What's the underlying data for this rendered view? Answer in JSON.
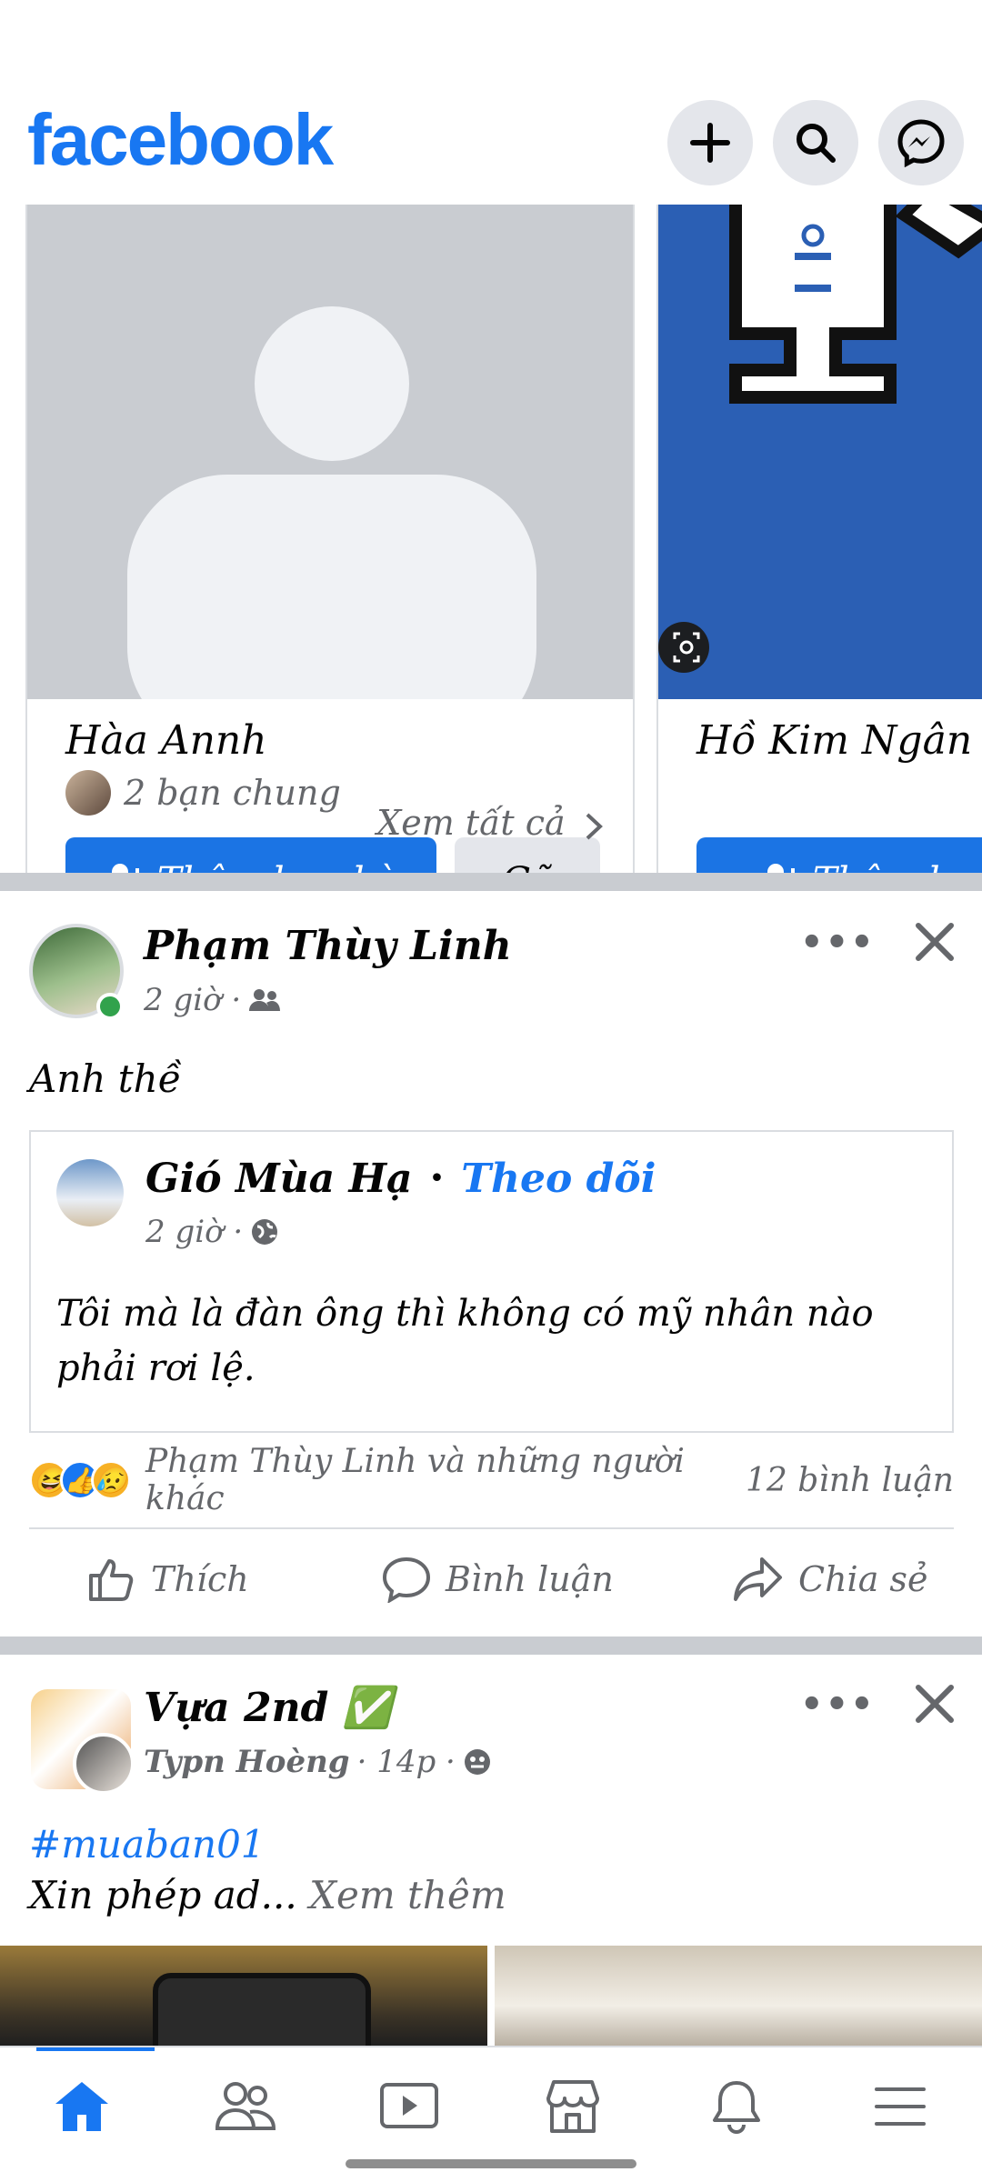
{
  "header": {
    "logo": "facebook",
    "icons": [
      "plus-icon",
      "search-icon",
      "messenger-icon"
    ]
  },
  "suggestions": [
    {
      "name": "Hàa Annh",
      "mutual": "2 bạn chung",
      "add_label": "Thêm bạn bè",
      "remove_label": "Gỡ"
    },
    {
      "name": "Hồ Kim Ngân",
      "add_label": "Thêm bạn"
    }
  ],
  "see_all": "Xem tất cả",
  "post1": {
    "author": "Phạm Thùy Linh",
    "time": "2 giờ ·",
    "text": "Anh thề",
    "shared": {
      "author": "Gió Mùa Hạ",
      "follow": "Theo dõi",
      "time": "2 giờ ·",
      "text_line1": "Tôi mà là đàn ông thì không có mỹ nhân nào",
      "text_line2": "phải rơi lệ."
    },
    "reactions_text": "Phạm Thùy Linh và những người khác",
    "comments": "12 bình luận",
    "actions": {
      "like": "Thích",
      "comment": "Bình luận",
      "share": "Chia sẻ"
    }
  },
  "post2": {
    "author": "Vựa 2nd",
    "verified": "✅",
    "sub_author": "Typn Hoèng",
    "time": "· 14p ·",
    "hashtag": "#muaban01",
    "text": "Xin phép ad...",
    "see_more": "Xem thêm"
  },
  "nav": {
    "items": [
      "home-icon",
      "friends-icon",
      "video-icon",
      "marketplace-icon",
      "notifications-icon",
      "menu-icon"
    ]
  }
}
